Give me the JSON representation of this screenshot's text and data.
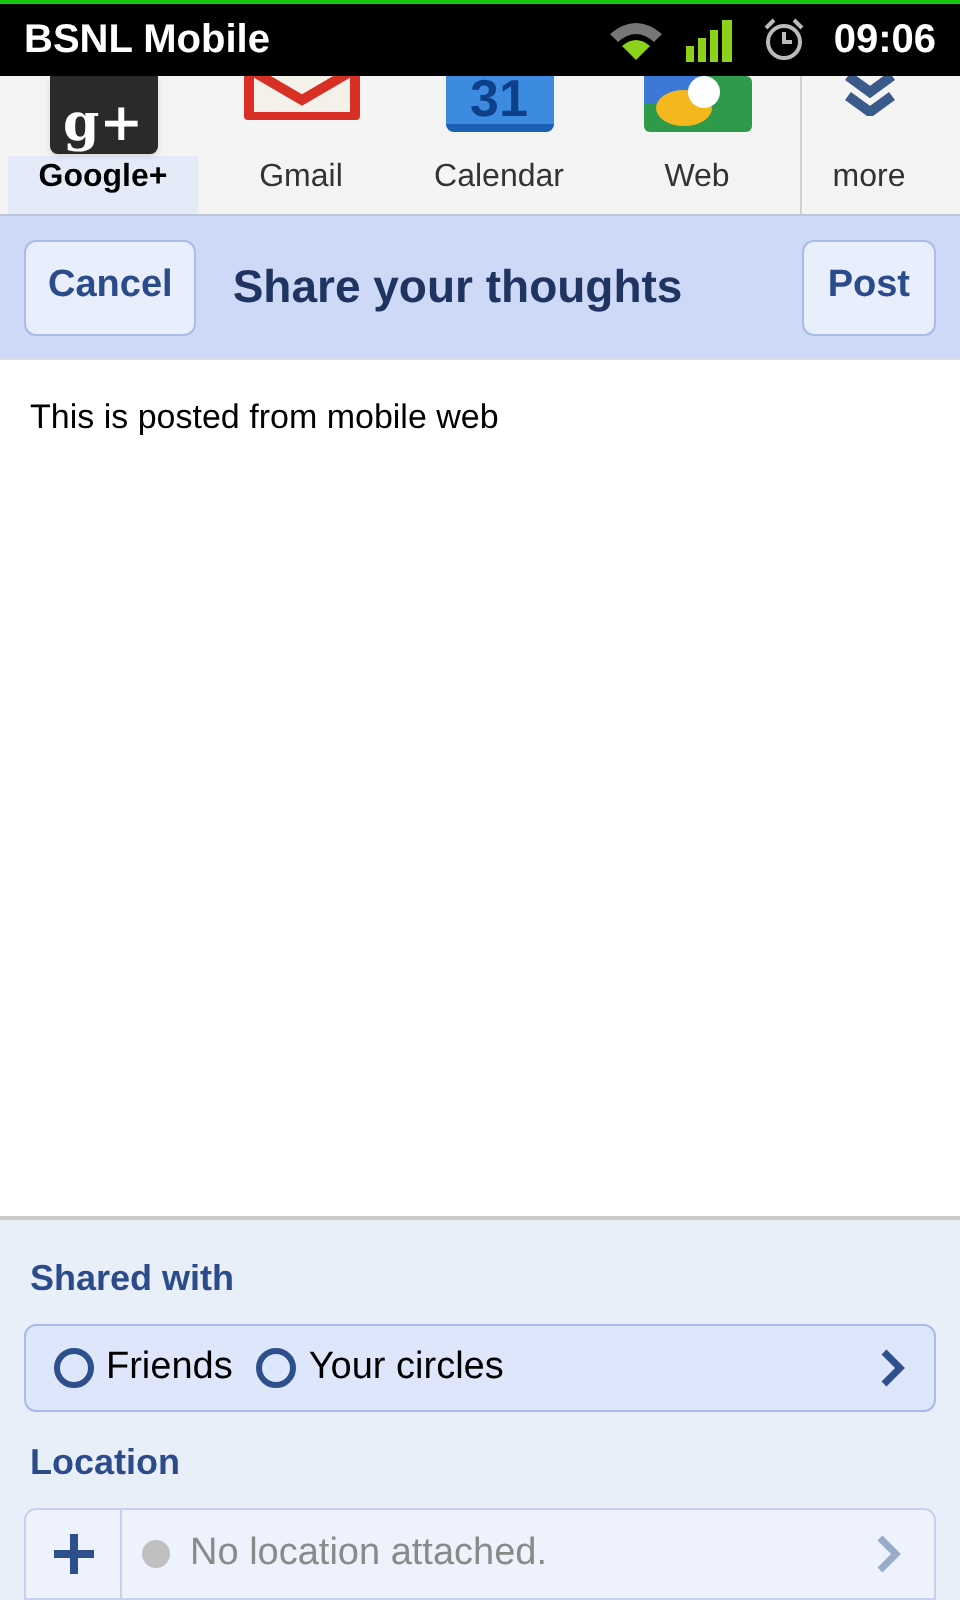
{
  "status_bar": {
    "carrier": "BSNL Mobile",
    "time": "09:06"
  },
  "tabs": [
    {
      "kind": "gplus",
      "label": "Google+",
      "icon_text": "g+",
      "selected": true
    },
    {
      "kind": "gmail",
      "label": "Gmail",
      "selected": false
    },
    {
      "kind": "calendar",
      "label": "Calendar",
      "icon_text": "31",
      "selected": false
    },
    {
      "kind": "web",
      "label": "Web",
      "selected": false
    },
    {
      "kind": "more",
      "label": "more",
      "selected": false
    }
  ],
  "header": {
    "cancel": "Cancel",
    "title": "Share your thoughts",
    "post": "Post"
  },
  "post_text": "This is posted from mobile web",
  "shared_with": {
    "heading": "Shared with",
    "options": [
      {
        "label": "Friends",
        "selected": false
      },
      {
        "label": "Your circles",
        "selected": false
      }
    ]
  },
  "location": {
    "heading": "Location",
    "text": "No location attached.",
    "attached": false
  }
}
